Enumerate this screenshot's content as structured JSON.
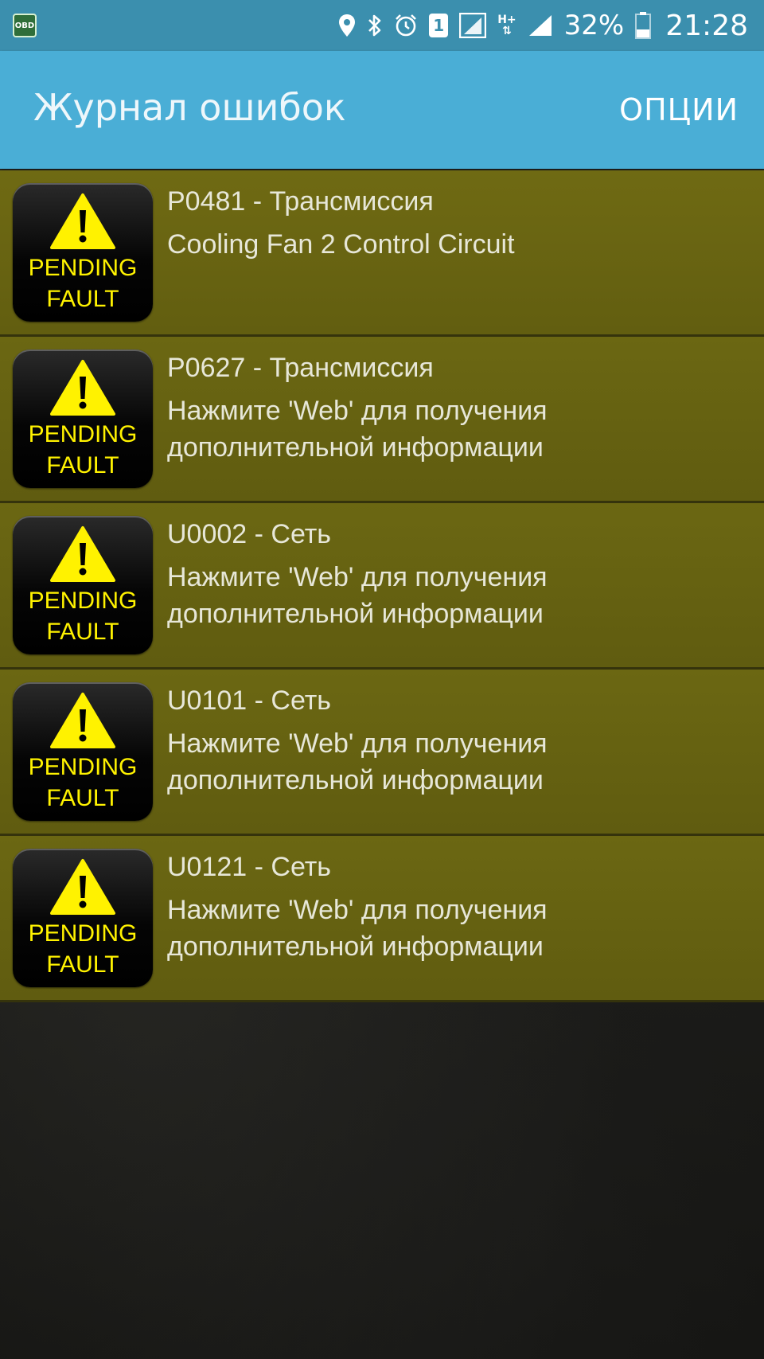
{
  "status_bar": {
    "app_icon_label": "OBD",
    "sim_slot": "1",
    "network_type": "H+",
    "battery": "32%",
    "time": "21:28"
  },
  "app_bar": {
    "title": "Журнал ошибок",
    "options_label": "ОПЦИИ"
  },
  "faults": [
    {
      "code": "P0481 - Трансмиссия",
      "description": "Cooling Fan 2 Control Circuit",
      "badge_line1": "PENDING",
      "badge_line2": "FAULT"
    },
    {
      "code": "P0627 - Трансмиссия",
      "description": "Нажмите 'Web' для получения дополнительной информации",
      "badge_line1": "PENDING",
      "badge_line2": "FAULT"
    },
    {
      "code": "U0002 - Сеть",
      "description": "Нажмите 'Web' для получения дополнительной информации",
      "badge_line1": "PENDING",
      "badge_line2": "FAULT"
    },
    {
      "code": "U0101 - Сеть",
      "description": "Нажмите 'Web' для получения дополнительной информации",
      "badge_line1": "PENDING",
      "badge_line2": "FAULT"
    },
    {
      "code": "U0121 - Сеть",
      "description": "Нажмите 'Web' для получения дополнительной информации",
      "badge_line1": "PENDING",
      "badge_line2": "FAULT"
    }
  ],
  "colors": {
    "status_bar": "#3b8fae",
    "app_bar": "#4aaed6",
    "row_background": "#66620f",
    "badge_text": "#fff200"
  },
  "icons": [
    "obd-app-icon",
    "location-icon",
    "bluetooth-icon",
    "alarm-icon",
    "sim-icon",
    "signal-icon",
    "battery-icon",
    "warning-triangle-icon"
  ]
}
